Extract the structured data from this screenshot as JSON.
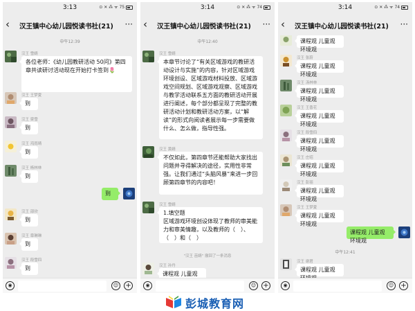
{
  "phones": [
    {
      "time": "3:13",
      "status_right": "⊙ ✕ ⁂ ᯤ 75",
      "title": "汉王镇中心幼儿园悦读书社(21)",
      "timestamp": "中午12:39",
      "messages": [
        {
          "sender": "汉王 雪婧",
          "text": "各位老师：《幼儿园教研活动 50问》第四章共读研讨活动现在开始打卡签到🌷"
        },
        {
          "sender": "汉王 王梦夏",
          "text": "到"
        },
        {
          "sender": "汉王 梁雪",
          "text": "到"
        },
        {
          "sender": "汉王 鸿雨晴",
          "text": "到"
        },
        {
          "sender": "汉王 杨林林",
          "text": "到"
        },
        {
          "sender": "",
          "text": "到",
          "self": true
        },
        {
          "sender": "汉王 邵欣",
          "text": "到"
        },
        {
          "sender": "汉王 章琳琳",
          "text": "到"
        },
        {
          "sender": "汉王 段雪四",
          "text": "到"
        }
      ]
    },
    {
      "time": "3:14",
      "status_right": "⊙ ✕ ⁂ ᯤ 74",
      "title": "汉王镇中心幼儿园悦读书社(21)",
      "timestamp": "中午12:40",
      "messages": [
        {
          "sender": "汉王 雪婧",
          "text": "本章节讨论了“有关区域游戏的教研活动设计与实施”的内容，针对区域游戏环境创设、区域游戏材料投放、区域游戏空间规划、区域游戏观察、区域游戏与教学活动联系五方面的教研活动开展进行阐述，每个部分都呈现了完整的教研活动计划和教研活动方案，以“解读”的形式向阅读者展示每一步需要做什么、怎么做，指导性强。"
        },
        {
          "sender": "汉王 黄婧",
          "text": "不仅如此，第四章节还能帮助大家找出问题并寻得解决的途径，实用性非常强。让我们通过“头脑风暴”来进一步回顾第四章节的内容吧！"
        },
        {
          "sender": "汉王 雪婧",
          "text": "1.填空题\n区域游戏环境创设体现了教师的审美能力和审美情趣，以及教师的（　）、（　）和（　）"
        }
      ],
      "recall_notice": "\"汉王 苗婧\" 撤回了一条消息",
      "last_sender": "汉王 孙丹",
      "last_text": "课程观 儿童观 环境观"
    },
    {
      "time": "3:14",
      "status_right": "⊙ ✕ ⁂ ᯤ 74",
      "title": "汉王镇中心幼儿园悦读书社(21)",
      "messages": [
        {
          "sender": "",
          "text": "课程观 儿童观 环境观"
        },
        {
          "sender": "汉王 张蔚",
          "text": "课程观 儿童观 环境观"
        },
        {
          "sender": "汉王 汤林林",
          "text": "课程观 儿童观 环境观"
        },
        {
          "sender": "汉王 王香花",
          "text": "课程观 儿童观 环境观"
        },
        {
          "sender": "汉王 段雪四",
          "text": "课程观 儿童观 环境观"
        },
        {
          "sender": "汉王 庄昭",
          "text": "课程观 儿童观 环境观"
        },
        {
          "sender": "汉王 彭丽",
          "text": "课程观 儿童观 环境观"
        },
        {
          "sender": "汉王 王梦夏",
          "text": "课程观 儿童观 环境观"
        },
        {
          "sender": "",
          "text": "课程观 儿童观 环境观",
          "self": true
        },
        {
          "sender": "汉王 谢君",
          "text": "课程观 儿童观 环境观"
        }
      ],
      "timestamp": "中午12:41"
    }
  ],
  "watermark": "彭城教育网"
}
